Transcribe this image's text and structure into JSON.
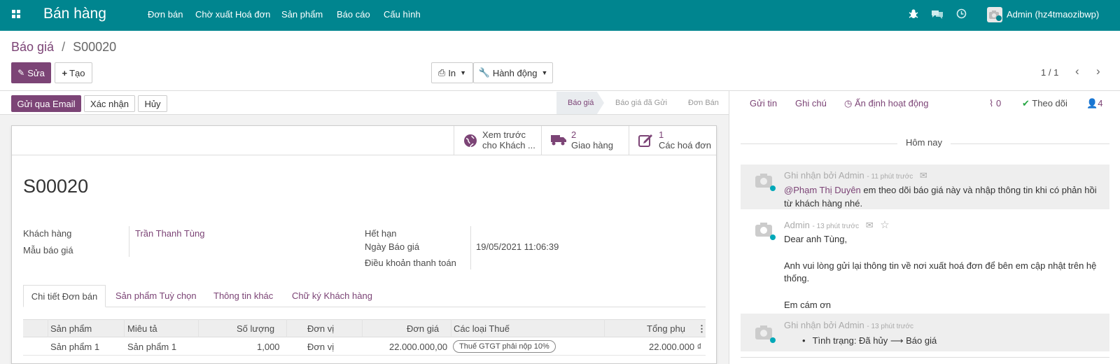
{
  "nav": {
    "app_title": "Bán hàng",
    "menu": [
      "Đơn bán",
      "Chờ xuất Hoá đơn",
      "Sản phẩm",
      "Báo cáo",
      "Cấu hình"
    ],
    "user": "Admin (hz4tmaozibwp)"
  },
  "breadcrumb": {
    "parent": "Báo giá",
    "sep": "/",
    "current": "S00020"
  },
  "toolbar": {
    "edit": "Sửa",
    "create": "Tạo",
    "print": "In",
    "action": "Hành động",
    "pager": "1 / 1"
  },
  "statusbar": {
    "send_email": "Gửi qua Email",
    "confirm": "Xác nhận",
    "cancel": "Hủy",
    "stages": [
      "Báo giá",
      "Báo giá đã Gửi",
      "Đơn Bán"
    ]
  },
  "smart_buttons": {
    "preview_line1": "Xem trước",
    "preview_line2": "cho Khách ...",
    "delivery_count": "2",
    "delivery_label": "Giao hàng",
    "invoice_count": "1",
    "invoice_label": "Các hoá đơn"
  },
  "form": {
    "name": "S00020",
    "customer_label": "Khách hàng",
    "customer_value": "Trần Thanh Tùng",
    "template_label": "Mẫu báo giá",
    "expiry_label": "Hết hạn",
    "date_label": "Ngày Báo giá",
    "date_value": "19/05/2021 11:06:39",
    "payment_terms_label": "Điều khoản thanh toán"
  },
  "tabs": [
    "Chi tiết Đơn bán",
    "Sản phẩm Tuỳ chọn",
    "Thông tin khác",
    "Chữ ký Khách hàng"
  ],
  "table": {
    "headers": [
      "Sản phẩm",
      "Miêu tả",
      "Số lượng",
      "Đơn vị",
      "Đơn giá",
      "Các loại Thuế",
      "Tổng phụ"
    ],
    "rows": [
      [
        "Sản phẩm 1",
        "Sản phẩm 1",
        "1,000",
        "Đơn vị",
        "22.000.000,00",
        "Thuế GTGT phải nộp 10%",
        "22.000.000 ₫"
      ]
    ]
  },
  "chatter": {
    "send_message": "Gửi tin",
    "log_note": "Ghi chú",
    "schedule": "Ấn định hoạt động",
    "attachments": "0",
    "follow": "Theo dõi",
    "followers": "4",
    "today": "Hôm nay",
    "messages": [
      {
        "author": "Ghi nhận bởi Admin",
        "time": "- 11 phút trước",
        "mention": "@Phạm Thị Duyên",
        "text1": " em theo dõi báo giá này và nhập thông tin khi có phản hồi",
        "text2": "từ khách hàng nhé."
      },
      {
        "author": "Admin",
        "time": "- 13 phút trước",
        "line1": "Dear anh Tùng,",
        "line2": "Anh vui lòng gửi lại thông tin về nơi xuất hoá đơn để bên em cập nhật trên hệ",
        "line3": "thống.",
        "line4": "Em cám ơn"
      },
      {
        "author": "Ghi nhận bởi Admin",
        "time": "- 13 phút trước",
        "bullet": "Tình trạng: Đã hủy ⟶ Báo giá"
      }
    ]
  }
}
